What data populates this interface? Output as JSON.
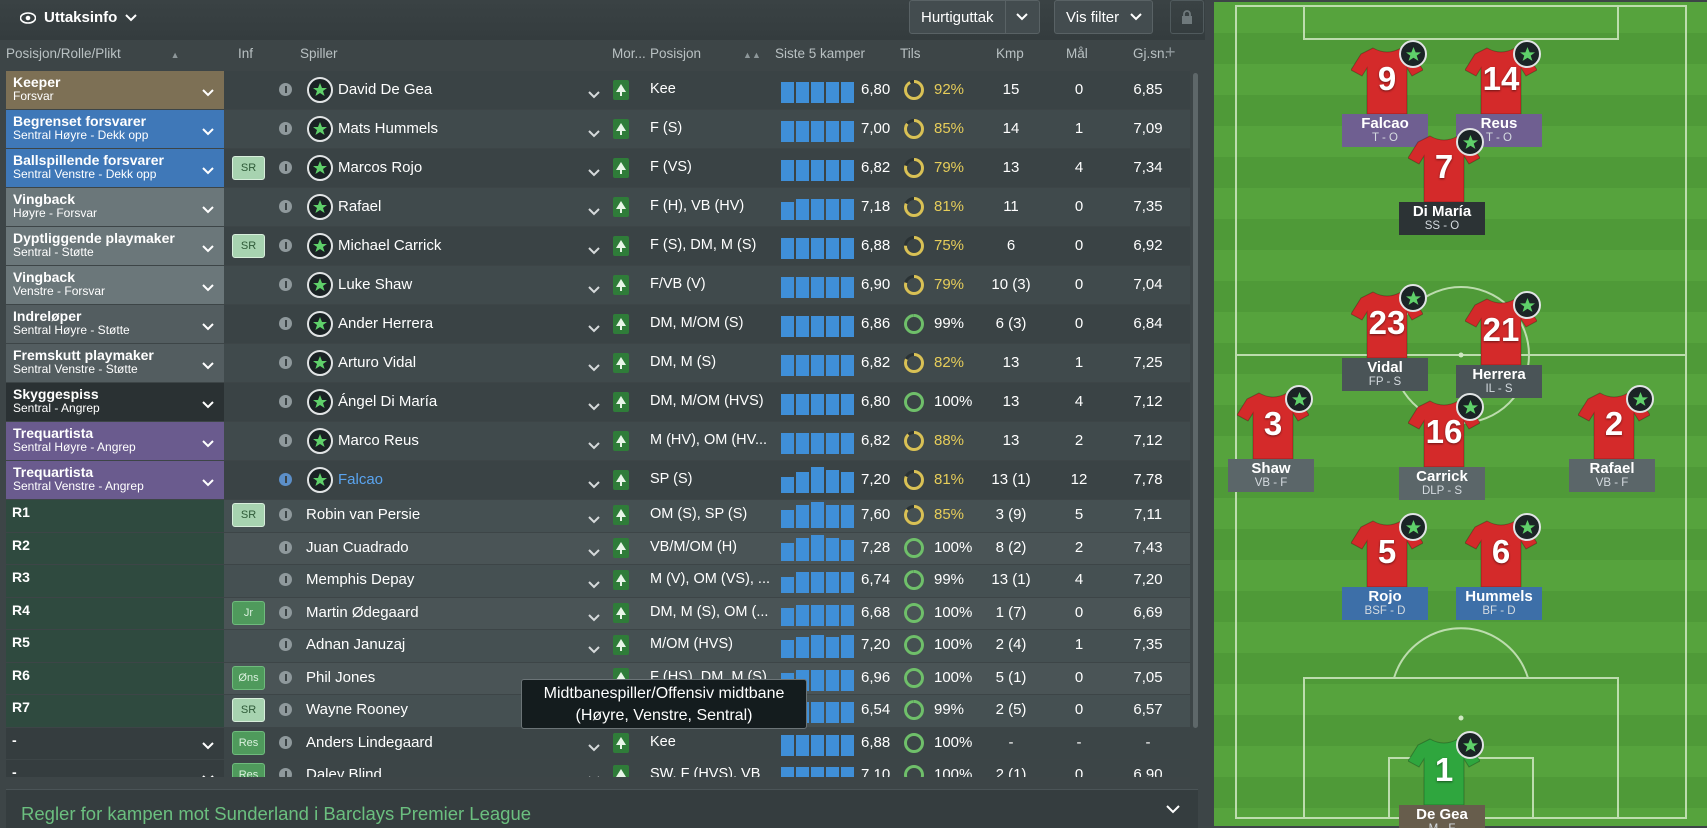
{
  "topbar": {
    "view_label": "Uttaksinfo",
    "quick_pick_label": "Hurtiguttak",
    "filter_label": "Vis filter"
  },
  "columns": {
    "role": "Posisjon/Rolle/Plikt",
    "inf": "Inf",
    "player": "Spiller",
    "morale": "Mor...",
    "position": "Posisjon",
    "last5": "Siste 5 kamper",
    "fitness": "Tils",
    "apps": "Kmp",
    "goals": "Mål",
    "avg": "Gj.sn."
  },
  "colors": {
    "gk": "#7d7055",
    "def": "#3f78b8",
    "wb": "#6b777a",
    "mid": "#535d60",
    "am": "#2a3133",
    "att": "#6a5b8e",
    "sub_bg": "#2f4a3f",
    "accent_green": "#6bbf7f",
    "bar_blue": "#3f8fd8"
  },
  "lineup": [
    {
      "role": "Keeper",
      "duty": "Forsvar",
      "tag": "",
      "name": "David De Gea",
      "pos": "Kee",
      "bars": [
        0.8,
        0.8,
        0.8,
        0.8,
        0.8
      ],
      "rating": "6,80",
      "fit_pct": 0.92,
      "fitness": "92%",
      "apps": "15",
      "goals": "0",
      "avg": "6,85"
    },
    {
      "role": "Begrenset forsvarer",
      "duty": "Sentral Høyre - Dekk opp",
      "tag": "",
      "name": "Mats Hummels",
      "pos": "F (S)",
      "bars": [
        0.8,
        0.8,
        0.8,
        0.8,
        0.8
      ],
      "rating": "7,00",
      "fit_pct": 0.85,
      "fitness": "85%",
      "apps": "14",
      "goals": "1",
      "avg": "7,09"
    },
    {
      "role": "Ballspillende forsvarer",
      "duty": "Sentral Venstre - Dekk opp",
      "tag": "SR",
      "name": "Marcos Rojo",
      "pos": "F (VS)",
      "bars": [
        0.8,
        0.8,
        0.8,
        0.8,
        0.8
      ],
      "rating": "6,82",
      "fit_pct": 0.79,
      "fitness": "79%",
      "apps": "13",
      "goals": "4",
      "avg": "7,34"
    },
    {
      "role": "Vingback",
      "duty": "Høyre - Forsvar",
      "tag": "",
      "name": "Rafael",
      "pos": "F (H), VB (HV)",
      "bars": [
        0.7,
        0.8,
        0.8,
        0.8,
        0.8
      ],
      "rating": "7,18",
      "fit_pct": 0.81,
      "fitness": "81%",
      "apps": "11",
      "goals": "0",
      "avg": "7,35"
    },
    {
      "role": "Dyptliggende playmaker",
      "duty": "Sentral - Støtte",
      "tag": "SR",
      "name": "Michael Carrick",
      "pos": "F (S), DM, M (S)",
      "bars": [
        0.8,
        0.8,
        0.8,
        0.8,
        0.8
      ],
      "rating": "6,88",
      "fit_pct": 0.75,
      "fitness": "75%",
      "apps": "6",
      "goals": "0",
      "avg": "6,92"
    },
    {
      "role": "Vingback",
      "duty": "Venstre - Forsvar",
      "tag": "",
      "name": "Luke Shaw",
      "pos": "F/VB (V)",
      "bars": [
        0.8,
        0.8,
        0.8,
        0.8,
        0.8
      ],
      "rating": "6,90",
      "fit_pct": 0.79,
      "fitness": "79%",
      "apps": "10 (3)",
      "goals": "0",
      "avg": "7,04"
    },
    {
      "role": "Indreløper",
      "duty": "Sentral Høyre - Støtte",
      "tag": "",
      "name": "Ander Herrera",
      "pos": "DM, M/OM (S)",
      "bars": [
        0.8,
        0.8,
        0.8,
        0.8,
        0.8
      ],
      "rating": "6,86",
      "fit_pct": 0.99,
      "fitness": "99%",
      "apps": "6 (3)",
      "goals": "0",
      "avg": "6,84"
    },
    {
      "role": "Fremskutt playmaker",
      "duty": "Sentral Venstre - Støtte",
      "tag": "",
      "name": "Arturo Vidal",
      "pos": "DM, M (S)",
      "bars": [
        0.8,
        0.8,
        0.8,
        0.8,
        0.8
      ],
      "rating": "6,82",
      "fit_pct": 0.82,
      "fitness": "82%",
      "apps": "13",
      "goals": "1",
      "avg": "7,25"
    },
    {
      "role": "Skyggespiss",
      "duty": "Sentral - Angrep",
      "tag": "",
      "name": "Ángel Di María",
      "pos": "DM, M/OM (HVS)",
      "bars": [
        0.8,
        0.8,
        0.8,
        0.8,
        0.8
      ],
      "rating": "6,80",
      "fit_pct": 1.0,
      "fitness": "100%",
      "apps": "13",
      "goals": "4",
      "avg": "7,12"
    },
    {
      "role": "Trequartista",
      "duty": "Sentral Høyre - Angrep",
      "tag": "",
      "name": "Marco Reus",
      "pos": "M (HV), OM (HV...",
      "bars": [
        0.8,
        0.8,
        0.8,
        0.8,
        0.8
      ],
      "rating": "6,82",
      "fit_pct": 0.88,
      "fitness": "88%",
      "apps": "13",
      "goals": "2",
      "avg": "7,12"
    },
    {
      "role": "Trequartista",
      "duty": "Sentral Venstre - Angrep",
      "tag": "",
      "name": "Falcao",
      "pos": "SP (S)",
      "bars": [
        0.6,
        0.8,
        1.0,
        0.9,
        0.8
      ],
      "rating": "7,20",
      "fit_pct": 0.81,
      "fitness": "81%",
      "apps": "13 (1)",
      "goals": "12",
      "avg": "7,78"
    }
  ],
  "subs": [
    {
      "slot": "R1",
      "tag": "SR",
      "name": "Robin van Persie",
      "pos": "OM (S), SP (S)",
      "bars": [
        0.7,
        0.9,
        1.0,
        0.9,
        0.9
      ],
      "rating": "7,60",
      "fit_pct": 0.85,
      "fitness": "85%",
      "apps": "3 (9)",
      "goals": "5",
      "avg": "7,11"
    },
    {
      "slot": "R2",
      "tag": "",
      "name": "Juan Cuadrado",
      "pos": "VB/M/OM (H)",
      "bars": [
        0.7,
        0.9,
        1.0,
        0.9,
        0.8
      ],
      "rating": "7,28",
      "fit_pct": 1.0,
      "fitness": "100%",
      "apps": "8 (2)",
      "goals": "2",
      "avg": "7,43"
    },
    {
      "slot": "R3",
      "tag": "",
      "name": "Memphis Depay",
      "pos": "M (V), OM (VS), ...",
      "bars": [
        0.6,
        0.8,
        0.8,
        0.8,
        0.8
      ],
      "rating": "6,74",
      "fit_pct": 0.99,
      "fitness": "99%",
      "apps": "13 (1)",
      "goals": "4",
      "avg": "7,20"
    },
    {
      "slot": "R4",
      "tag": "Jr",
      "name": "Martin Ødegaard",
      "pos": "DM, M (S), OM (...",
      "bars": [
        0.7,
        0.8,
        0.8,
        0.8,
        0.8
      ],
      "rating": "6,68",
      "fit_pct": 1.0,
      "fitness": "100%",
      "apps": "1 (7)",
      "goals": "0",
      "avg": "6,69"
    },
    {
      "slot": "R5",
      "tag": "",
      "name": "Adnan Januzaj",
      "pos": "M/OM (HVS)",
      "bars": [
        0.7,
        0.8,
        0.9,
        0.8,
        0.9
      ],
      "rating": "7,20",
      "fit_pct": 1.0,
      "fitness": "100%",
      "apps": "2 (4)",
      "goals": "1",
      "avg": "7,35"
    },
    {
      "slot": "R6",
      "tag": "Øns",
      "name": "Phil Jones",
      "pos": "F (HS), DM, M (S)",
      "bars": [
        0.7,
        0.8,
        0.8,
        0.8,
        0.8
      ],
      "rating": "6,96",
      "fit_pct": 1.0,
      "fitness": "100%",
      "apps": "5 (1)",
      "goals": "0",
      "avg": "7,05"
    },
    {
      "slot": "R7",
      "tag": "SR",
      "name": "Wayne Rooney",
      "pos": "",
      "bars": [
        0.6,
        0.8,
        0.8,
        0.8,
        0.8
      ],
      "rating": "6,54",
      "fit_pct": 0.99,
      "fitness": "99%",
      "apps": "2 (5)",
      "goals": "0",
      "avg": "6,57"
    }
  ],
  "reserves": [
    {
      "slot": "-",
      "tag": "Res",
      "name": "Anders Lindegaard",
      "pos": "Kee",
      "bars": [
        0.8,
        0.8,
        0.8,
        0.8,
        0.8
      ],
      "rating": "6,88",
      "fit_pct": 1.0,
      "fitness": "100%",
      "apps": "-",
      "goals": "-",
      "avg": "-"
    },
    {
      "slot": "-",
      "tag": "Res",
      "name": "Daley Blind",
      "pos": "SW, F (HVS), VB",
      "bars": [
        0.8,
        0.8,
        0.8,
        0.8,
        0.8
      ],
      "rating": "7,10",
      "fit_pct": 1.0,
      "fitness": "100%",
      "apps": "2 (1)",
      "goals": "0",
      "avg": "6,90"
    }
  ],
  "tooltip": {
    "line1": "Midtbanespiller/Offensiv midtbane",
    "line2": "(Høyre, Venstre, Sentral)"
  },
  "footer": {
    "text": "Regler for kampen mot Sunderland i Barclays Premier League"
  },
  "pitch": [
    {
      "num": "9",
      "name": "Falcao",
      "role": "T - O",
      "label": "att",
      "kit": "red"
    },
    {
      "num": "14",
      "name": "Reus",
      "role": "T - O",
      "label": "att",
      "kit": "red"
    },
    {
      "num": "7",
      "name": "Di María",
      "role": "SS - O",
      "label": "dark",
      "kit": "red"
    },
    {
      "num": "23",
      "name": "Vidal",
      "role": "FP - S",
      "label": "mid",
      "kit": "red"
    },
    {
      "num": "21",
      "name": "Herrera",
      "role": "IL - S",
      "label": "mid",
      "kit": "red"
    },
    {
      "num": "3",
      "name": "Shaw",
      "role": "VB - F",
      "label": "wb",
      "kit": "red"
    },
    {
      "num": "16",
      "name": "Carrick",
      "role": "DLP - S",
      "label": "wb",
      "kit": "red"
    },
    {
      "num": "2",
      "name": "Rafael",
      "role": "VB - F",
      "label": "wb",
      "kit": "red"
    },
    {
      "num": "5",
      "name": "Rojo",
      "role": "BSF - D",
      "label": "def",
      "kit": "red"
    },
    {
      "num": "6",
      "name": "Hummels",
      "role": "BF - D",
      "label": "def",
      "kit": "red"
    },
    {
      "num": "1",
      "name": "De Gea",
      "role": "M - F",
      "label": "gk",
      "kit": "green"
    }
  ]
}
